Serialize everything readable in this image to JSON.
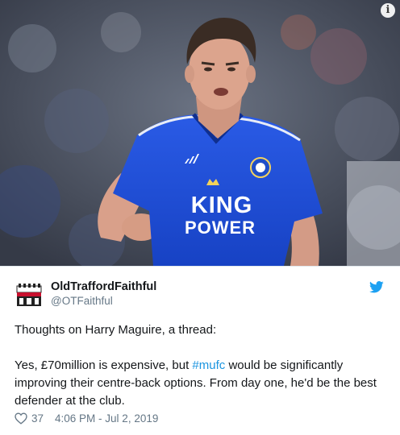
{
  "tweet": {
    "display_name": "OldTraffordFaithful",
    "handle": "@OTFaithful",
    "text_line1": "Thoughts on Harry Maguire, a thread:",
    "text_part_before_hashtag": "Yes, £70million is expensive, but ",
    "hashtag": "#mufc",
    "text_part_after_hashtag": " would be significantly improving their centre-back options. From day one, he'd be the best defender at the club.",
    "likes": "37",
    "timestamp": "4:06 PM - Jul 2, 2019"
  },
  "media": {
    "shirt_sponsor_line1": "KING",
    "shirt_sponsor_line2": "POWER",
    "kit_brand": "adidas",
    "info_symbol": "i"
  },
  "icons": {
    "info": "info-icon",
    "twitter": "twitter-bird-icon",
    "like": "heart-icon"
  },
  "colors": {
    "twitter_blue": "#1da1f2",
    "hashtag_blue": "#1b95e0",
    "secondary_text": "#657786",
    "shirt_blue": "#1b4fd8"
  }
}
